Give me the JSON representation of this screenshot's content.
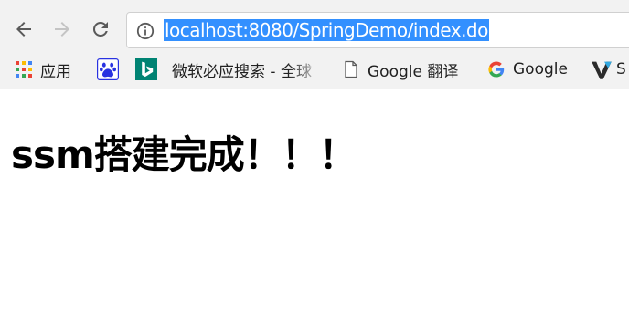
{
  "browser": {
    "url": "localhost:8080/SpringDemo/index.do"
  },
  "bookmarks": [
    {
      "icon": "apps-grid-icon",
      "label": "应用"
    },
    {
      "icon": "baidu-paw-icon",
      "label": ""
    },
    {
      "icon": "bing-icon",
      "label": "微软必应搜索 - 全球"
    },
    {
      "icon": "page-icon",
      "label": "Google 翻译"
    },
    {
      "icon": "google-g-icon",
      "label": "Google"
    },
    {
      "icon": "v-logo-icon",
      "label": "S"
    }
  ],
  "page": {
    "heading": "ssm搭建完成！！！"
  },
  "colors": {
    "url_highlight": "#3390ff",
    "chrome_bg": "#f2f2f2"
  }
}
